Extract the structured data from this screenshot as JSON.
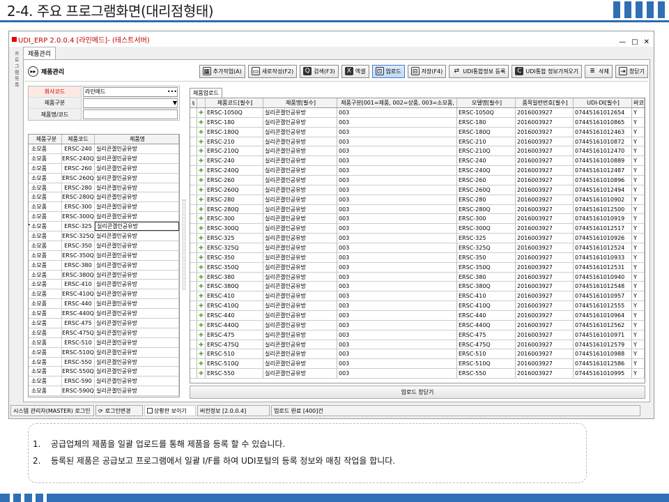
{
  "slide": {
    "title": "2-4. 주요 프로그램화면(대리점형태)"
  },
  "window": {
    "title": "UDI_ERP 2.0.0.4 [라인메드]- (테스트서버)",
    "min": "—",
    "max": "□",
    "close": "✕",
    "side_labels": [
      "프",
      "로",
      "그",
      "램",
      "목",
      "록"
    ]
  },
  "tab": {
    "label": "제품관리"
  },
  "toolbar": {
    "title": "제품관리",
    "buttons": [
      {
        "label": "추가작업(A)",
        "icon": "grid-icon"
      },
      {
        "label": "새로작성(F2)",
        "icon": "new-doc-icon"
      },
      {
        "label": "검색(F3)",
        "icon": "search-icon"
      },
      {
        "label": "엑셀",
        "icon": "excel-icon"
      },
      {
        "label": "업로드",
        "icon": "upload-icon"
      },
      {
        "label": "저장(F4)",
        "icon": "save-icon"
      },
      {
        "label": "UDI통합정보 등록",
        "icon": "sync-icon"
      },
      {
        "label": "UDI통합 정보가져오기",
        "icon": "fetch-icon"
      },
      {
        "label": "삭제",
        "icon": "delete-icon"
      },
      {
        "label": "창닫기",
        "icon": "exit-icon"
      }
    ]
  },
  "form": {
    "company_label": "회사코드",
    "company_value": "라인메드",
    "type_label": "제품구분",
    "type_value": "",
    "name_label": "제품명/코드",
    "name_value": ""
  },
  "left_table": {
    "headers": [
      "제품구분",
      "제품코드",
      "제품명"
    ],
    "rows": [
      [
        "소모품",
        "ERSC-240",
        "실리콘겔인공유방"
      ],
      [
        "소모품",
        "ERSC-240Q",
        "실리콘겔인공유방"
      ],
      [
        "소모품",
        "ERSC-260",
        "실리콘겔인공유방"
      ],
      [
        "소모품",
        "ERSC-260Q",
        "실리콘겔인공유방"
      ],
      [
        "소모품",
        "ERSC-280",
        "실리콘겔인공유방"
      ],
      [
        "소모품",
        "ERSC-280Q",
        "실리콘겔인공유방"
      ],
      [
        "소모품",
        "ERSC-300",
        "실리콘겔인공유방"
      ],
      [
        "소모품",
        "ERSC-300Q",
        "실리콘겔인공유방"
      ],
      [
        "소모품",
        "ERSC-325",
        "실리콘겔인공유방"
      ],
      [
        "소모품",
        "ERSC-325Q",
        "실리콘겔인공유방"
      ],
      [
        "소모품",
        "ERSC-350",
        "실리콘겔인공유방"
      ],
      [
        "소모품",
        "ERSC-350Q",
        "실리콘겔인공유방"
      ],
      [
        "소모품",
        "ERSC-380",
        "실리콘겔인공유방"
      ],
      [
        "소모품",
        "ERSC-380Q",
        "실리콘겔인공유방"
      ],
      [
        "소모품",
        "ERSC-410",
        "실리콘겔인공유방"
      ],
      [
        "소모품",
        "ERSC-410Q",
        "실리콘겔인공유방"
      ],
      [
        "소모품",
        "ERSC-440",
        "실리콘겔인공유방"
      ],
      [
        "소모품",
        "ERSC-440Q",
        "실리콘겔인공유방"
      ],
      [
        "소모품",
        "ERSC-475",
        "실리콘겔인공유방"
      ],
      [
        "소모품",
        "ERSC-475Q",
        "실리콘겔인공유방"
      ],
      [
        "소모품",
        "ERSC-510",
        "실리콘겔인공유방"
      ],
      [
        "소모품",
        "ERSC-510Q",
        "실리콘겔인공유방"
      ],
      [
        "소모품",
        "ERSC-550",
        "실리콘겔인공유방"
      ],
      [
        "소모품",
        "ERSC-550Q",
        "실리콘겔인공유방"
      ],
      [
        "소모품",
        "ERSC-590",
        "실리콘겔인공유방"
      ],
      [
        "소모품",
        "ERSC-590Q",
        "실리콘겔인공유방"
      ]
    ],
    "selected_index": 8
  },
  "right_tab": {
    "label": "제품업로드"
  },
  "right_table": {
    "headers": [
      "§",
      "",
      "제품코드[필수]",
      "제품명[필수]",
      "제품구분[001=제품, 002=상품, 003=소모품,",
      "모델명[필수]",
      "품목일련번호[필수]",
      "UDI-DI[필수]",
      "바코"
    ],
    "rows": [
      [
        "ERSC-1050Q",
        "실리콘겔인공유방",
        "003",
        "ERSC-1050Q",
        "2016003927",
        "07445161012654",
        "Y"
      ],
      [
        "ERSC-180",
        "실리콘겔인공유방",
        "003",
        "ERSC-180",
        "2016003927",
        "07445161010865",
        "Y"
      ],
      [
        "ERSC-180Q",
        "실리콘겔인공유방",
        "003",
        "ERSC-180Q",
        "2016003927",
        "07445161012463",
        "Y"
      ],
      [
        "ERSC-210",
        "실리콘겔인공유방",
        "003",
        "ERSC-210",
        "2016003927",
        "07445161010872",
        "Y"
      ],
      [
        "ERSC-210Q",
        "실리콘겔인공유방",
        "003",
        "ERSC-210Q",
        "2016003927",
        "07445161012470",
        "Y"
      ],
      [
        "ERSC-240",
        "실리콘겔인공유방",
        "003",
        "ERSC-240",
        "2016003927",
        "07445161010889",
        "Y"
      ],
      [
        "ERSC-240Q",
        "실리콘겔인공유방",
        "003",
        "ERSC-240Q",
        "2016003927",
        "07445161012487",
        "Y"
      ],
      [
        "ERSC-260",
        "실리콘겔인공유방",
        "003",
        "ERSC-260",
        "2016003927",
        "07445161010896",
        "Y"
      ],
      [
        "ERSC-260Q",
        "실리콘겔인공유방",
        "003",
        "ERSC-260Q",
        "2016003927",
        "07445161012494",
        "Y"
      ],
      [
        "ERSC-280",
        "실리콘겔인공유방",
        "003",
        "ERSC-280",
        "2016003927",
        "07445161010902",
        "Y"
      ],
      [
        "ERSC-280Q",
        "실리콘겔인공유방",
        "003",
        "ERSC-280Q",
        "2016003927",
        "07445161012500",
        "Y"
      ],
      [
        "ERSC-300",
        "실리콘겔인공유방",
        "003",
        "ERSC-300",
        "2016003927",
        "07445161010919",
        "Y"
      ],
      [
        "ERSC-300Q",
        "실리콘겔인공유방",
        "003",
        "ERSC-300Q",
        "2016003927",
        "07445161012517",
        "Y"
      ],
      [
        "ERSC-325",
        "실리콘겔인공유방",
        "003",
        "ERSC-325",
        "2016003927",
        "07445161010926",
        "Y"
      ],
      [
        "ERSC-325Q",
        "실리콘겔인공유방",
        "003",
        "ERSC-325Q",
        "2016003927",
        "07445161012524",
        "Y"
      ],
      [
        "ERSC-350",
        "실리콘겔인공유방",
        "003",
        "ERSC-350",
        "2016003927",
        "07445161010933",
        "Y"
      ],
      [
        "ERSC-350Q",
        "실리콘겔인공유방",
        "003",
        "ERSC-350Q",
        "2016003927",
        "07445161012531",
        "Y"
      ],
      [
        "ERSC-380",
        "실리콘겔인공유방",
        "003",
        "ERSC-380",
        "2016003927",
        "07445161010940",
        "Y"
      ],
      [
        "ERSC-380Q",
        "실리콘겔인공유방",
        "003",
        "ERSC-380Q",
        "2016003927",
        "07445161012548",
        "Y"
      ],
      [
        "ERSC-410",
        "실리콘겔인공유방",
        "003",
        "ERSC-410",
        "2016003927",
        "07445161010957",
        "Y"
      ],
      [
        "ERSC-410Q",
        "실리콘겔인공유방",
        "003",
        "ERSC-410Q",
        "2016003927",
        "07445161012555",
        "Y"
      ],
      [
        "ERSC-440",
        "실리콘겔인공유방",
        "003",
        "ERSC-440",
        "2016003927",
        "07445161010964",
        "Y"
      ],
      [
        "ERSC-440Q",
        "실리콘겔인공유방",
        "003",
        "ERSC-440Q",
        "2016003927",
        "07445161012562",
        "Y"
      ],
      [
        "ERSC-475",
        "실리콘겔인공유방",
        "003",
        "ERSC-475",
        "2016003927",
        "07445161010971",
        "Y"
      ],
      [
        "ERSC-475Q",
        "실리콘겔인공유방",
        "003",
        "ERSC-475Q",
        "2016003927",
        "07445161012579",
        "Y"
      ],
      [
        "ERSC-510",
        "실리콘겔인공유방",
        "003",
        "ERSC-510",
        "2016003927",
        "07445161010988",
        "Y"
      ],
      [
        "ERSC-510Q",
        "실리콘겔인공유방",
        "003",
        "ERSC-510Q",
        "2016003927",
        "07445161012586",
        "Y"
      ],
      [
        "ERSC-550",
        "실리콘겔인공유방",
        "003",
        "ERSC-550",
        "2016003927",
        "07445161010995",
        "Y"
      ]
    ]
  },
  "upload_close": {
    "label": "업로드 창닫기"
  },
  "status": {
    "user": "시스템 관리자(MASTER) 로그인",
    "relogin": "로그인변경",
    "checkbox": "상황판 보이기",
    "version": "버전정보 [2.0.0.4]",
    "message": "업로드 완료 [400]건"
  },
  "notes": [
    {
      "num": "1.",
      "text": "공급업체의 제품을 일괄 업로드를 통해 제품을 등록 할 수 있습니다."
    },
    {
      "num": "2.",
      "text": "등록된 제품은 공급보고 프로그램에서 일괄 I/F를 하여 UDI포털의 등록 정보와 매칭 작업을 합니다."
    }
  ],
  "colors": {
    "accent": "#2f6fb5",
    "title_red": "#c00000",
    "plus_green": "#5aa332"
  }
}
